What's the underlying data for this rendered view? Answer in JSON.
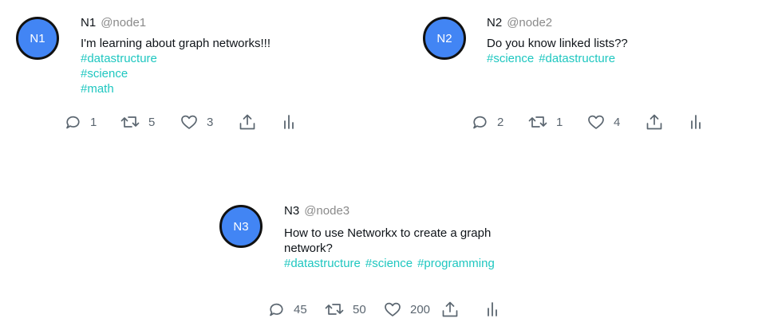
{
  "posts": [
    {
      "avatar": "N1",
      "name": "N1",
      "handle": "@node1",
      "text": "I'm learning about graph networks!!!",
      "hashtags": [
        "#datastructure",
        "#science",
        "#math"
      ],
      "counts": {
        "reply": "1",
        "retweet": "5",
        "like": "3"
      }
    },
    {
      "avatar": "N2",
      "name": "N2",
      "handle": "@node2",
      "text": "Do you know linked lists??",
      "hashtags": [
        "#science",
        "#datastructure"
      ],
      "counts": {
        "reply": "2",
        "retweet": "1",
        "like": "4"
      }
    },
    {
      "avatar": "N3",
      "name": "N3",
      "handle": "@node3",
      "text": "How to use Networkx to create a graph network?",
      "hashtags": [
        "#datastructure",
        "#science",
        "#programming"
      ],
      "counts": {
        "reply": "45",
        "retweet": "50",
        "like": "200"
      }
    }
  ],
  "icons": [
    "reply-icon",
    "retweet-icon",
    "like-icon",
    "share-icon",
    "analytics-icon"
  ],
  "colors": {
    "avatar": "#4285f4",
    "hashtag": "#1fc7c0",
    "handle": "#8a8a8a",
    "icon": "#5b6670"
  }
}
